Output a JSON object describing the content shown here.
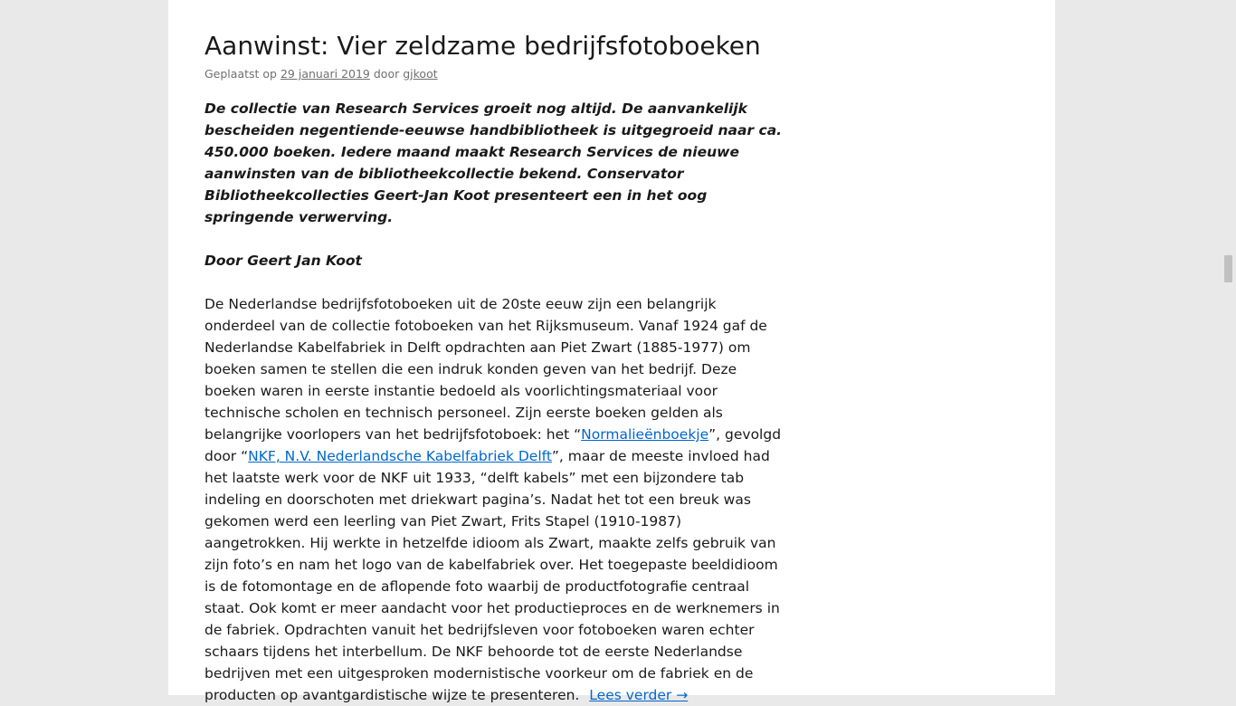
{
  "post": {
    "title": "Aanwinst: Vier zeldzame bedrijfsfotoboeken",
    "meta": {
      "posted_label": "Geplaatst op",
      "date": "29 januari 2019",
      "by_label": "door",
      "author": "gjkoot"
    },
    "intro": "De collectie van Research Services groeit nog altijd. De aanvankelijk bescheiden negentiende-eeuwse handbibliotheek is uitgegroeid naar ca. 450.000 boeken. Iedere maand maakt Research Services de nieuwe aanwinsten van de bibliotheekcollectie bekend. Conservator Bibliotheekcollecties Geert-Jan Koot presenteert een in het oog springende verwerving.",
    "byline": "Door Geert Jan Koot",
    "body": {
      "part1": "De Nederlandse bedrijfsfotoboeken uit de 20ste eeuw zijn een belangrijk onderdeel van de collectie fotoboeken van het Rijksmuseum. Vanaf 1924 gaf de Nederlandse Kabelfabriek in Delft opdrachten aan Piet Zwart (1885-1977) om boeken samen te stellen die een indruk konden geven van het bedrijf. Deze boeken waren in eerste instantie bedoeld als voorlichtingsmateriaal voor technische scholen en technisch personeel. Zijn eerste boeken gelden als belangrijke voorlopers van het bedrijfsfotoboek: het “",
      "link1": "Normalieënboekje",
      "part2": "”, gevolgd door “",
      "link2": "NKF, N.V. Nederlandsche Kabelfabriek Delft",
      "part3": "”, maar de meeste invloed had het laatste werk voor de NKF uit 1933, “delft kabels” met een bijzondere tab indeling en doorschoten met driekwart pagina’s. Nadat het tot een breuk was gekomen werd een leerling van Piet Zwart, Frits Stapel (1910-1987) aangetrokken. Hij werkte in hetzelfde idioom als Zwart, maakte zelfs gebruik van zijn foto’s en nam het logo van de kabelfabriek over. Het toegepaste beeldidioom is de fotomontage en de aflopende foto waarbij de productfotografie centraal staat. Ook komt er meer aandacht voor het productieproces en de werknemers in de fabriek. Opdrachten vanuit het bedrijfsleven voor fotoboeken waren echter schaars tijdens het interbellum. De NKF behoorde tot de eerste Nederlandse bedrijven met een uitgesproken modernistische voorkeur om de fabriek en de producten op avantgardistische wijze te presenteren.",
      "read_more": "Lees verder →"
    }
  },
  "colors": {
    "page_bg": "#e9e9e9",
    "content_bg": "#ffffff",
    "text": "#1a1a1a",
    "meta": "#707070",
    "link": "#0066cc"
  }
}
